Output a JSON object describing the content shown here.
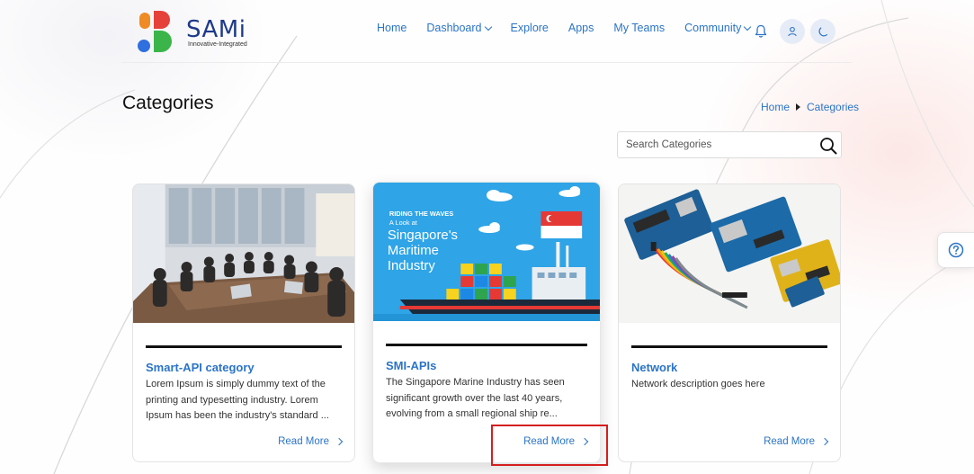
{
  "brand": {
    "name": "SAMi",
    "tagline": "Innovative-Integrated",
    "colors": {
      "orange": "#f08a24",
      "red": "#e5403a",
      "blue": "#2f6fe0",
      "green": "#3bb54a",
      "navy": "#1e3a8a"
    }
  },
  "nav": {
    "items": [
      {
        "label": "Home",
        "dropdown": false
      },
      {
        "label": "Dashboard",
        "dropdown": true
      },
      {
        "label": "Explore",
        "dropdown": false
      },
      {
        "label": "Apps",
        "dropdown": false
      },
      {
        "label": "My Teams",
        "dropdown": false
      },
      {
        "label": "Community",
        "dropdown": true
      }
    ],
    "icons": [
      "bell-icon",
      "user-icon",
      "moon-icon"
    ],
    "link_color": "#2b74c7"
  },
  "page": {
    "title": "Categories",
    "breadcrumb": [
      "Home",
      "Categories"
    ]
  },
  "search": {
    "placeholder": "Search Categories",
    "value": ""
  },
  "cards": [
    {
      "title": "Smart-API category",
      "description": "Lorem Ipsum is simply dummy text of the printing and typesetting industry. Lorem Ipsum has been the industry's standard ...",
      "read_more": "Read More",
      "image": "office-meeting-photo"
    },
    {
      "title": "SMI-APIs",
      "description": "The Singapore Marine Industry has seen significant growth over the last 40 years, evolving from a small regional ship re...",
      "read_more": "Read More",
      "image": "singapore-maritime-illustration",
      "image_text": {
        "line1": "RIDING THE WAVES",
        "line2": "A Look at",
        "line3": "Singapore's",
        "line4": "Maritime",
        "line5": "Industry"
      }
    },
    {
      "title": "Network",
      "description": "Network description goes here",
      "read_more": "Read More",
      "image": "arduino-boards-photo"
    }
  ],
  "help": {
    "icon": "question-icon"
  },
  "highlight": {
    "color": "#d51e1e",
    "target": "card-2-read-more"
  }
}
